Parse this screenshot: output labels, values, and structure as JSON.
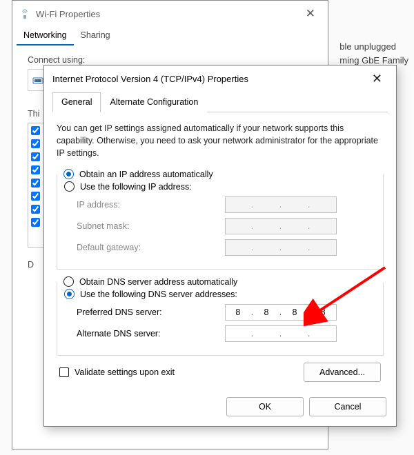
{
  "bg": {
    "line1": "ble unplugged",
    "line2": "ming GbE Family"
  },
  "wifi": {
    "title": "Wi-Fi Properties",
    "tabs": {
      "networking": "Networking",
      "sharing": "Sharing"
    },
    "connect_using": "Connect using:",
    "this_items": "Thi",
    "description": "D"
  },
  "ipv4": {
    "title": "Internet Protocol Version 4 (TCP/IPv4) Properties",
    "tabs": {
      "general": "General",
      "alt": "Alternate Configuration"
    },
    "desc": "You can get IP settings assigned automatically if your network supports this capability. Otherwise, you need to ask your network administrator for the appropriate IP settings.",
    "ip_auto": "Obtain an IP address automatically",
    "ip_manual": "Use the following IP address:",
    "ip_address_label": "IP address:",
    "subnet_label": "Subnet mask:",
    "gateway_label": "Default gateway:",
    "dns_auto": "Obtain DNS server address automatically",
    "dns_manual": "Use the following DNS server addresses:",
    "pref_dns_label": "Preferred DNS server:",
    "alt_dns_label": "Alternate DNS server:",
    "pref_dns_value": [
      "8",
      "8",
      "8",
      "8"
    ],
    "alt_dns_value": [
      "",
      "",
      "",
      ""
    ],
    "validate": "Validate settings upon exit",
    "advanced": "Advanced...",
    "ok": "OK",
    "cancel": "Cancel"
  }
}
